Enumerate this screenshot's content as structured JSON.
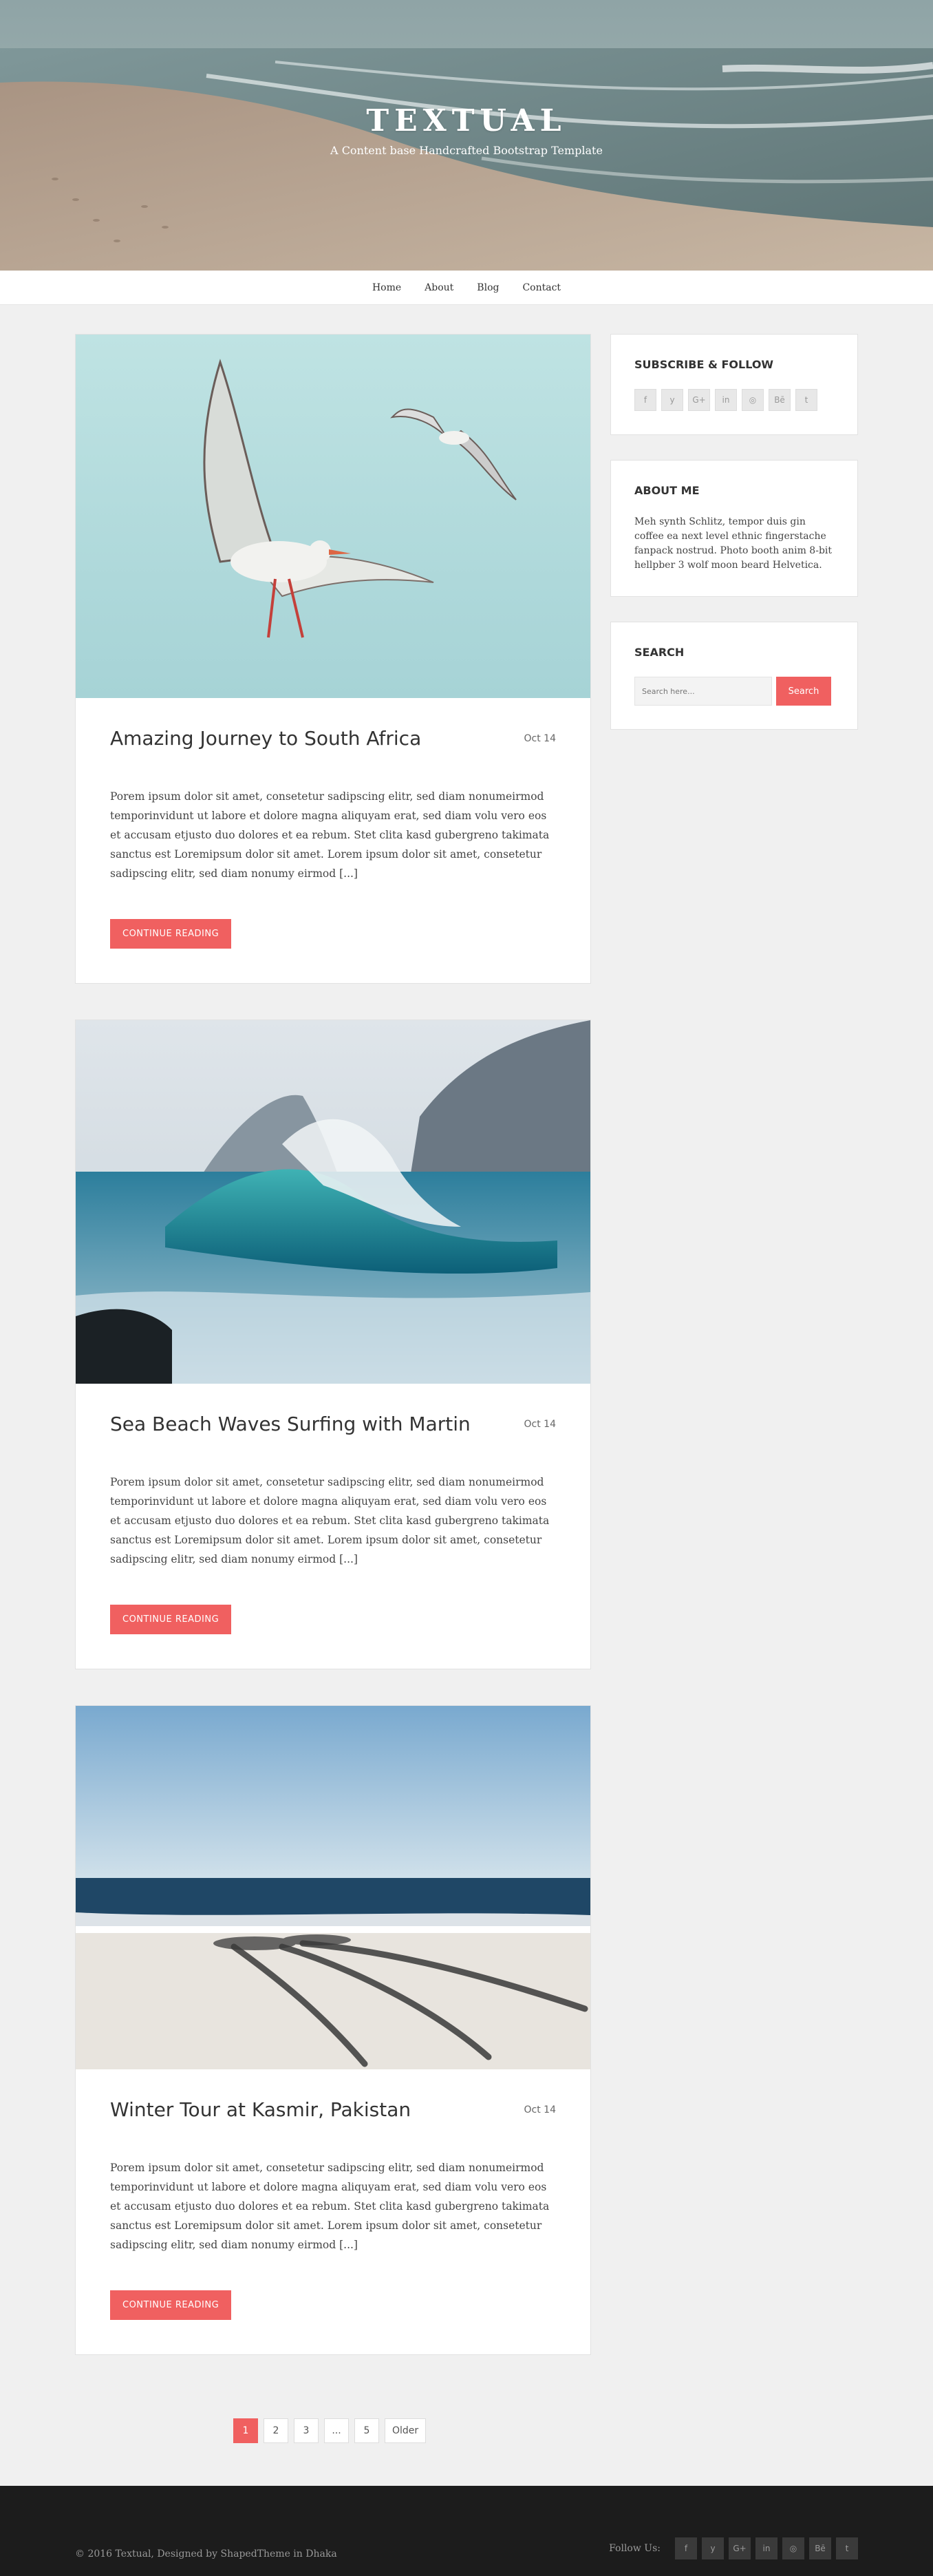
{
  "site": {
    "title": "TEXTUAL",
    "tagline": "A Content base Handcrafted Bootstrap Template"
  },
  "nav": {
    "items": [
      {
        "label": "Home"
      },
      {
        "label": "About"
      },
      {
        "label": "Blog"
      },
      {
        "label": "Contact"
      }
    ]
  },
  "posts": [
    {
      "title": "Amazing Journey to South Africa",
      "date": "Oct 14",
      "excerpt": "Porem ipsum dolor sit amet, consetetur sadipscing elitr, sed diam nonumeirmod temporinvidunt ut labore et dolore magna aliquyam erat, sed diam volu vero eos et accusam etjusto duo dolores et ea rebum. Stet clita kasd gubergreno takimata sanctus est Loremipsum dolor sit amet. Lorem ipsum dolor sit amet, consetetur sadipscing elitr, sed diam nonumy eirmod [...]",
      "button": "CONTINUE READING",
      "image": "seagulls-sky"
    },
    {
      "title": "Sea Beach Waves Surfing with Martin",
      "date": "Oct 14",
      "excerpt": "Porem ipsum dolor sit amet, consetetur sadipscing elitr, sed diam nonumeirmod temporinvidunt ut labore et dolore magna aliquyam erat, sed diam volu vero eos et accusam etjusto duo dolores et ea rebum. Stet clita kasd gubergreno takimata sanctus est Loremipsum dolor sit amet. Lorem ipsum dolor sit amet, consetetur sadipscing elitr, sed diam nonumy eirmod [...]",
      "button": "CONTINUE READING",
      "image": "ocean-wave"
    },
    {
      "title": "Winter Tour at Kasmir, Pakistan",
      "date": "Oct 14",
      "excerpt": "Porem ipsum dolor sit amet, consetetur sadipscing elitr, sed diam nonumeirmod temporinvidunt ut labore et dolore magna aliquyam erat, sed diam volu vero eos et accusam etjusto duo dolores et ea rebum. Stet clita kasd gubergreno takimata sanctus est Loremipsum dolor sit amet. Lorem ipsum dolor sit amet, consetetur sadipscing elitr, sed diam nonumy eirmod [...]",
      "button": "CONTINUE READING",
      "image": "beach-palm-shadow"
    }
  ],
  "sidebar": {
    "subscribe": {
      "title": "SUBSCRIBE & FOLLOW",
      "icons": [
        {
          "name": "facebook-icon",
          "glyph": "f"
        },
        {
          "name": "twitter-icon",
          "glyph": "y"
        },
        {
          "name": "google-plus-icon",
          "glyph": "G+"
        },
        {
          "name": "linkedin-icon",
          "glyph": "in"
        },
        {
          "name": "instagram-icon",
          "glyph": "◎"
        },
        {
          "name": "behance-icon",
          "glyph": "Bē"
        },
        {
          "name": "tumblr-icon",
          "glyph": "t"
        }
      ]
    },
    "about": {
      "title": "ABOUT ME",
      "text": "Meh synth Schlitz, tempor duis gin coffee ea next level ethnic fingerstache fanpack nostrud. Photo booth anim 8-bit hellpber 3 wolf moon beard Helvetica."
    },
    "search": {
      "title": "SEARCH",
      "placeholder": "Search here...",
      "button": "Search"
    }
  },
  "pagination": {
    "pages": [
      "1",
      "2",
      "3",
      "...",
      "5",
      "Older"
    ],
    "active": "1"
  },
  "footer": {
    "copyright": "© 2016 Textual, Designed by ShapedTheme in Dhaka",
    "follow_label": "Follow Us:"
  },
  "colors": {
    "accent": "#f06060",
    "background": "#f0f0f0",
    "footer": "#1c1c1c"
  }
}
